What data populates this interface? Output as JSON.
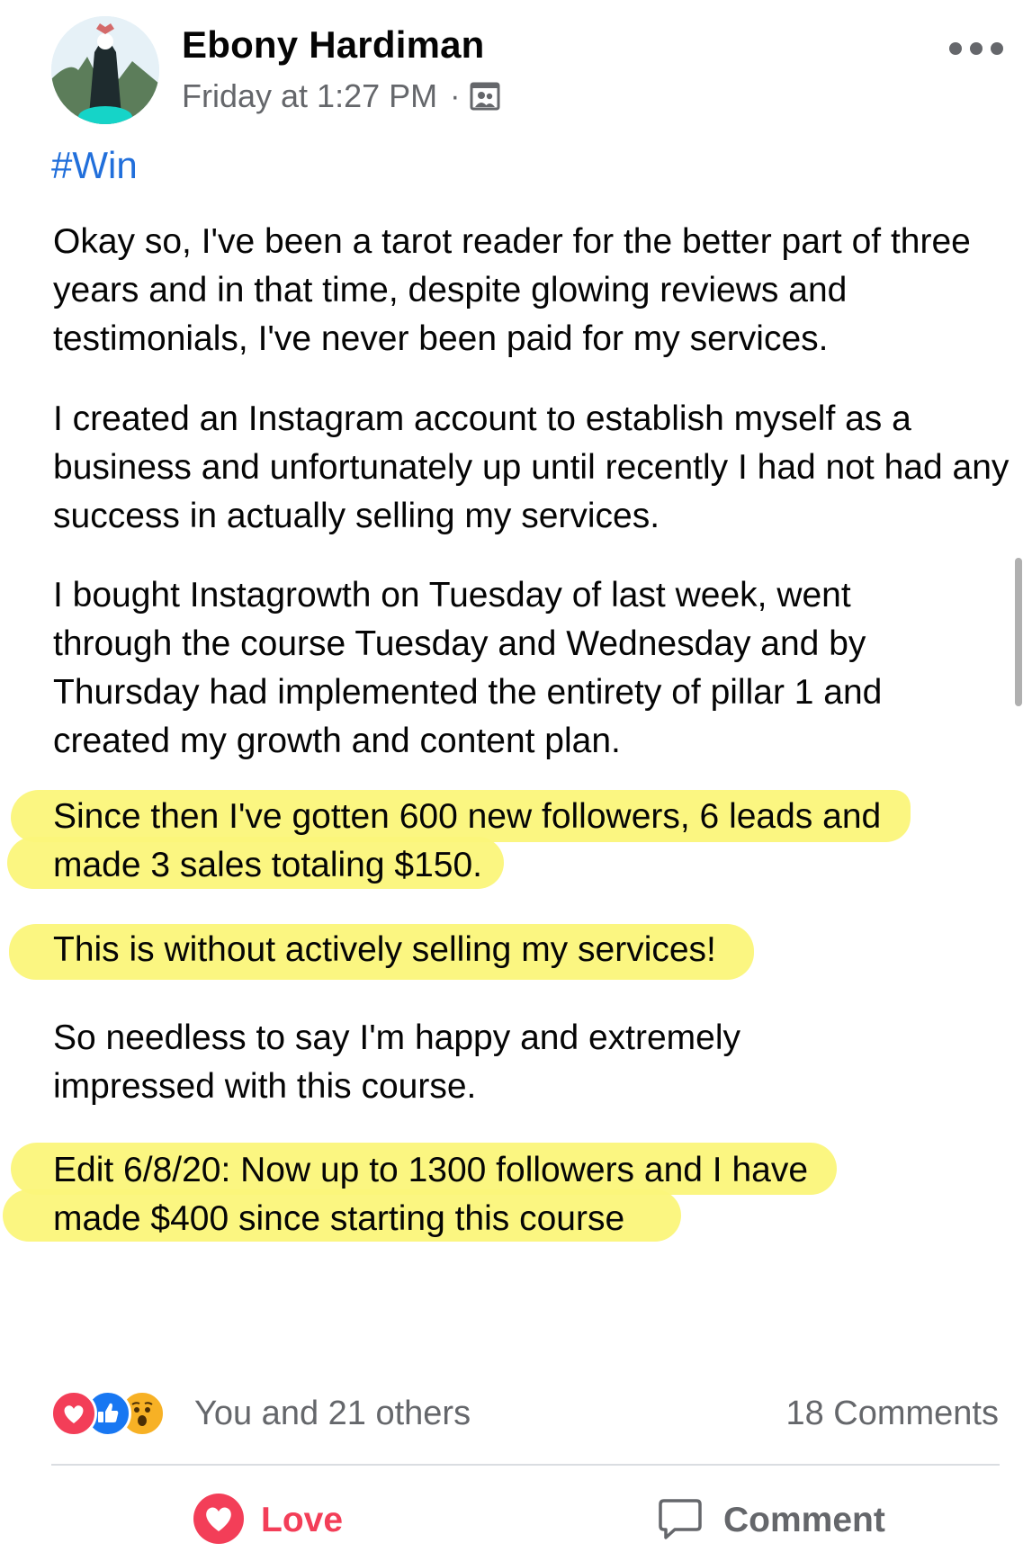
{
  "post": {
    "author": "Ebony Hardiman",
    "timestamp": "Friday at 1:27 PM",
    "separator": "·",
    "privacy_icon": "group-members-icon",
    "hashtag": "#Win",
    "paragraphs": [
      "Okay so, I've been a tarot reader for the better part of three years and in that time, despite glowing reviews and testimonials, I've never been paid for my services.",
      "I created an Instagram account to establish myself as a business and unfortunately up until recently I had not had any success in actually selling my services.",
      "I bought Instagrowth on Tuesday of last week, went through the course Tuesday and Wednesday and by Thursday had implemented the entirety of pillar 1 and created my growth and content plan.",
      "Since then I've gotten 600 new followers, 6 leads and made 3 sales totaling $150.",
      "This is without actively selling my services!",
      "So needless to say I'm happy and extremely impressed with this course.",
      "Edit 6/8/20: Now up to 1300 followers and I have made $400 since starting this course"
    ],
    "highlight_color": "#fbf67a"
  },
  "reactions": {
    "icons": [
      "love-reaction-icon",
      "like-reaction-icon",
      "wow-reaction-icon"
    ],
    "summary": "You and 21 others",
    "comments": "18 Comments"
  },
  "actions": {
    "love_label": "Love",
    "comment_label": "Comment"
  },
  "colors": {
    "link": "#216fdb",
    "love": "#f33e58",
    "like": "#1877f2",
    "secondary_text": "#65676b"
  }
}
